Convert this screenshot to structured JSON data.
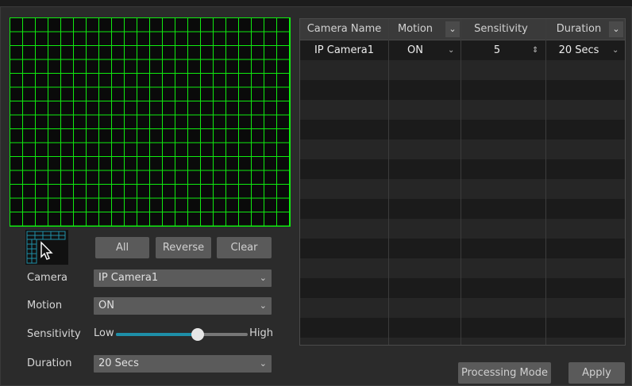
{
  "controls": {
    "all_label": "All",
    "reverse_label": "Reverse",
    "clear_label": "Clear"
  },
  "form": {
    "camera": {
      "label": "Camera",
      "value": "IP Camera1"
    },
    "motion": {
      "label": "Motion",
      "value": "ON"
    },
    "sensitivity": {
      "label": "Sensitivity",
      "low": "Low",
      "high": "High",
      "level": 0.62
    },
    "duration": {
      "label": "Duration",
      "value": "20 Secs"
    }
  },
  "table": {
    "headers": [
      "Camera Name",
      "Motion",
      "Sensitivity",
      "Duration"
    ],
    "rows": [
      {
        "camera_name": "IP Camera1",
        "motion": "ON",
        "sensitivity": "5",
        "duration": "20 Secs"
      }
    ]
  },
  "footer": {
    "processing_mode_label": "Processing Mode",
    "apply_label": "Apply"
  },
  "colors": {
    "grid": "#10ea10",
    "slider_fill": "#1e8fa8"
  }
}
